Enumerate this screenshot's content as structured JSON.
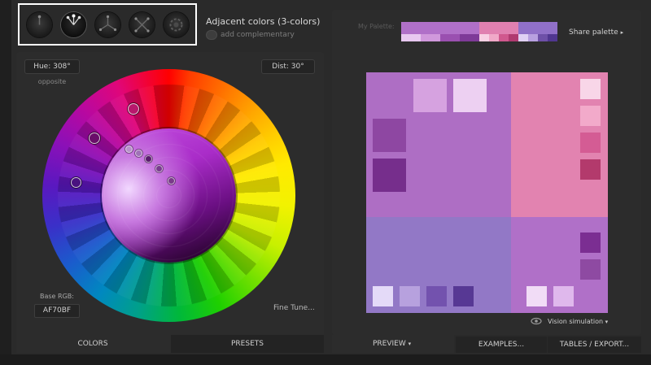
{
  "scheme": {
    "title": "Adjacent colors (3-colors)",
    "complementary_label": "add complementary",
    "buttons": [
      {
        "name": "scheme-mono-button",
        "icon": "mono-scheme-icon"
      },
      {
        "name": "scheme-adjacent-button",
        "icon": "adjacent-scheme-icon",
        "active": true
      },
      {
        "name": "scheme-triad-button",
        "icon": "triad-scheme-icon"
      },
      {
        "name": "scheme-tetrad-button",
        "icon": "tetrad-scheme-icon"
      },
      {
        "name": "scheme-freestyle-button",
        "icon": "freestyle-scheme-icon"
      }
    ]
  },
  "wheel": {
    "hue_label": "Hue: 308°",
    "opposite_label": "opposite",
    "dist_label": "Dist: 30°",
    "base_rgb_label": "Base RGB:",
    "base_rgb_value": "AF70BF",
    "fine_tune_label": "Fine Tune..."
  },
  "left_tabs": {
    "colors": "COLORS",
    "presets": "PRESETS"
  },
  "palette": {
    "label": "My Palette:",
    "share_label": "Share palette",
    "share_arrow": "▸",
    "groups": [
      {
        "main": "#B070C8",
        "subs": [
          "#E8C8F0",
          "#D098DC",
          "#9A50B0",
          "#7E3A98"
        ]
      },
      {
        "main": "#E080B0",
        "subs": [
          "#F8D0E4",
          "#F0A8C8",
          "#D0588E",
          "#B03A70"
        ]
      },
      {
        "main": "#9070C8",
        "subs": [
          "#E0D0F4",
          "#B8A0E0",
          "#6E50A8",
          "#503690"
        ]
      }
    ]
  },
  "preview": {
    "purple": "#AE6EC4",
    "pink": "#E283B0",
    "violet": "#9278C6",
    "purple2": "#B070C8",
    "purple_swatches": [
      "#D6A2E0",
      "#EDD0F2",
      "#8E47A2",
      "#762E8C"
    ],
    "pink_swatches": [
      "#F8D6E8",
      "#F2AACA",
      "#D45C94",
      "#B33A6C"
    ],
    "violet_swatches": [
      "#E4DAF8",
      "#B7A1DE",
      "#7352AE",
      "#573894"
    ],
    "br_swatches": [
      "#7B2E92",
      "#8E4AA2",
      "#F1DCF6",
      "#DFB8EC"
    ],
    "vision_label": "Vision simulation",
    "vision_arrow": "▾"
  },
  "right_tabs": {
    "preview": "PREVIEW",
    "preview_arrow": "▾",
    "examples": "EXAMPLES...",
    "tables": "TABLES / EXPORT..."
  }
}
